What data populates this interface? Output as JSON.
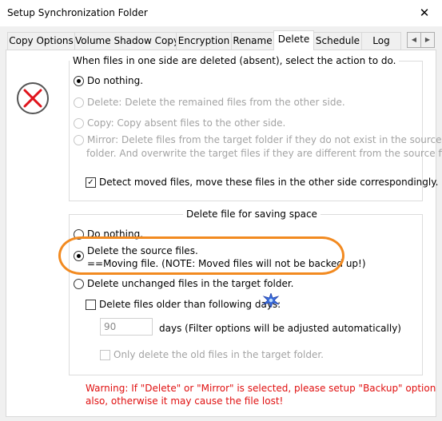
{
  "window": {
    "title": "Setup Synchronization Folder"
  },
  "tabs": [
    {
      "label": "Copy Options"
    },
    {
      "label": "Volume Shadow Copy"
    },
    {
      "label": "Encryption"
    },
    {
      "label": "Rename"
    },
    {
      "label": "Delete",
      "active": true
    },
    {
      "label": "Schedule"
    },
    {
      "label": "Log"
    }
  ],
  "group1": {
    "legend": "When files in one side are deleted (absent), select the action to do.",
    "options": [
      "Do nothing.",
      "Delete: Delete the remained files from the other side.",
      "Copy: Copy absent files to the other side.",
      "Mirror: Delete files from the target folder if they do not exist in the source",
      "folder. And overwrite the target files if they are different from the source files."
    ],
    "detect_moved": "Detect moved files, move these files in the other side correspondingly."
  },
  "group2": {
    "legend": "Delete file for saving space",
    "do_nothing": "Do nothing.",
    "delete_source": "Delete the source files.",
    "moving_note": "==Moving file. (NOTE: Moved files will not be backed up!)",
    "delete_unchanged": "Delete unchanged files in the target folder.",
    "older_than": "Delete files older than following days:",
    "days_value": "90",
    "days_label": "days (Filter options will be adjusted automatically)",
    "only_old": "Only delete the old files in the target folder."
  },
  "warning": {
    "line1": "Warning: If \"Delete\" or \"Mirror\" is selected, please setup \"Backup\" option",
    "line2": "also, otherwise it may cause the file lost!"
  },
  "colors": {
    "warning": "#e01010",
    "highlight": "#f28a20",
    "delete_icon": "#e0141c"
  },
  "icons": {
    "delete": "x-circle-icon",
    "close": "close-icon",
    "marker": "star-icon"
  }
}
